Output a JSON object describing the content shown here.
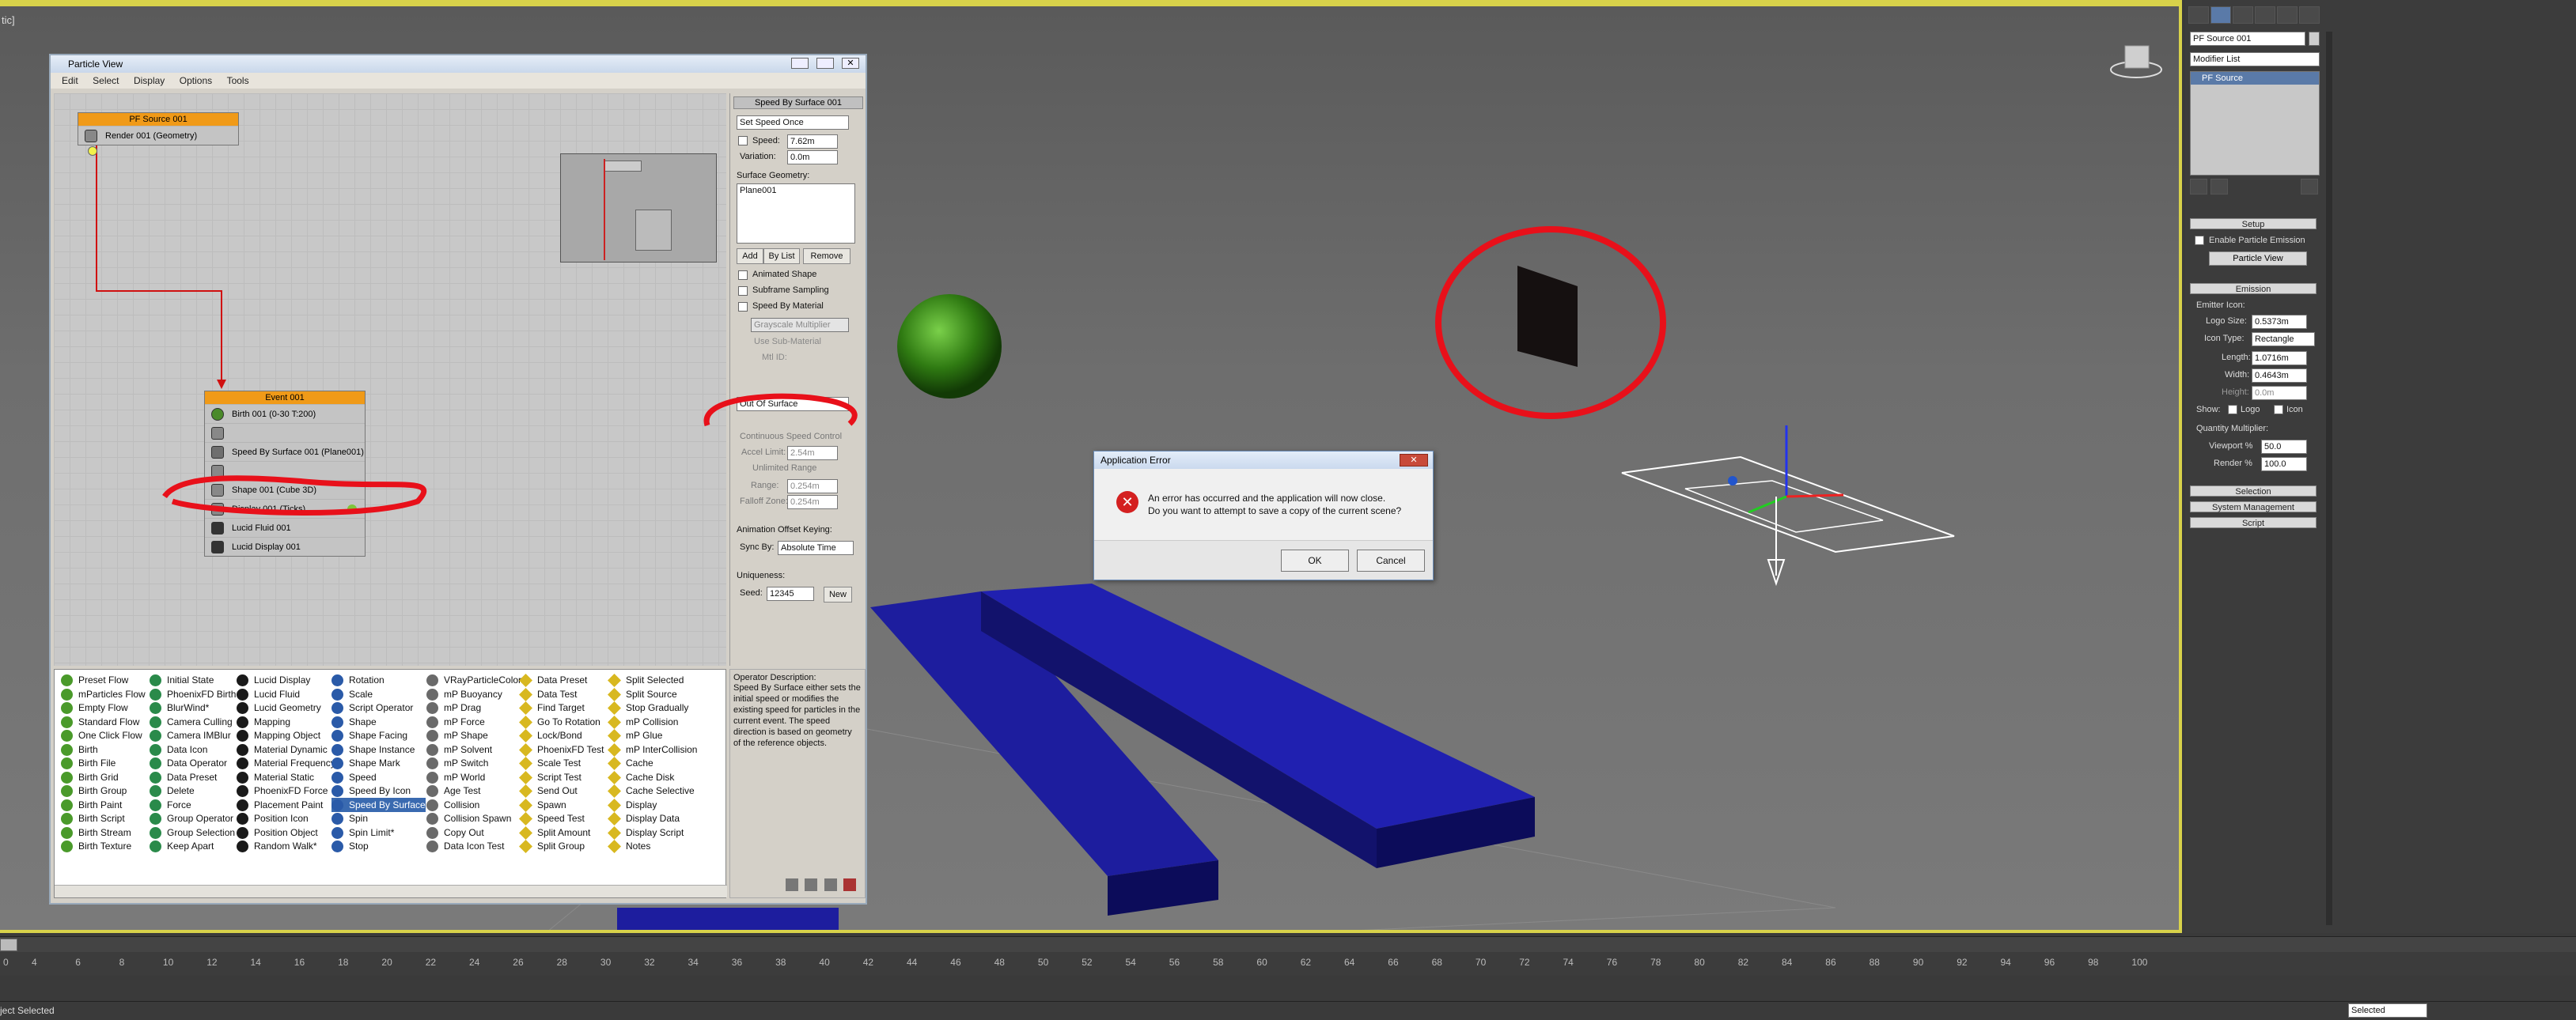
{
  "viewport": {
    "corner_label": "tic]"
  },
  "particle_view": {
    "title": "Particle View",
    "menu": [
      "Edit",
      "Select",
      "Display",
      "Options",
      "Tools"
    ],
    "pf_source": {
      "header": "PF Source 001",
      "row": "Render 001 (Geometry)"
    },
    "event": {
      "header": "Event 001",
      "rows": [
        "Birth 001 (0-30 T:200)",
        "",
        "Speed By Surface 001 (Plane001)",
        "",
        "Shape 001 (Cube 3D)",
        "Display 001 (Ticks)",
        "Lucid Fluid 001",
        "Lucid Display 001"
      ]
    },
    "params": {
      "rollout_title": "Speed By Surface 001",
      "mode": "Set Speed Once",
      "speed_label": "Speed:",
      "speed_value": "7.62m",
      "variation_label": "Variation:",
      "variation_value": "0.0m",
      "surface_geometry_label": "Surface Geometry:",
      "surface_item": "Plane001",
      "add": "Add",
      "by_list": "By List",
      "remove": "Remove",
      "animated_shape": "Animated Shape",
      "subframe_sampling": "Subframe Sampling",
      "speed_by_material": "Speed By Material",
      "grayscale": "Grayscale Multiplier",
      "use_sub_material": "Use Sub-Material",
      "mtl_id": "Mtl ID:",
      "direction": "Out Of Surface",
      "continuous": "Continuous Speed Control",
      "accel_limit": "Accel Limit:",
      "accel_value": "2.54m",
      "unlimited_range": "Unlimited Range",
      "range": "Range:",
      "range_value": "0.254m",
      "falloff_zone": "Falloff Zone:",
      "falloff_value": "0.254m",
      "anim_offset": "Animation Offset Keying:",
      "sync_by": "Sync By:",
      "sync_value": "Absolute Time",
      "uniqueness": "Uniqueness:",
      "seed": "Seed:",
      "seed_value": "12345",
      "new": "New"
    },
    "operator_description": {
      "title": "Operator Description:",
      "body": "Speed By Surface either sets the initial speed or modifies the existing speed for particles in the current event. The speed direction is based on geometry of the reference objects."
    },
    "depot": [
      [
        "Preset Flow",
        "mParticles Flow",
        "Empty Flow",
        "Standard Flow",
        "One Click Flow",
        "Birth",
        "Birth File",
        "Birth Grid",
        "Birth Group",
        "Birth Paint",
        "Birth Script",
        "Birth Stream",
        "Birth Texture"
      ],
      [
        "Initial State",
        "PhoenixFD Birth",
        "BlurWind*",
        "Camera Culling",
        "Camera IMBlur",
        "Data Icon",
        "Data Operator",
        "Data Preset",
        "Delete",
        "Force",
        "Group Operator",
        "Group Selection",
        "Keep Apart"
      ],
      [
        "Lucid Display",
        "Lucid Fluid",
        "Lucid Geometry",
        "Mapping",
        "Mapping Object",
        "Material Dynamic",
        "Material Frequency",
        "Material Static",
        "PhoenixFD Force",
        "Placement Paint",
        "Position Icon",
        "Position Object",
        "Random Walk*"
      ],
      [
        "Rotation",
        "Scale",
        "Script Operator",
        "Shape",
        "Shape Facing",
        "Shape Instance",
        "Shape Mark",
        "Speed",
        "Speed By Icon",
        "Speed By Surface",
        "Spin",
        "Spin Limit*",
        "Stop"
      ],
      [
        "VRayParticleColor",
        "mP Buoyancy",
        "mP Drag",
        "mP Force",
        "mP Shape",
        "mP Solvent",
        "mP Switch",
        "mP World",
        "Age Test",
        "Collision",
        "Collision Spawn",
        "Copy Out",
        "Data Icon Test"
      ],
      [
        "Data Preset",
        "Data Test",
        "Find Target",
        "Go To Rotation",
        "Lock/Bond",
        "PhoenixFD Test",
        "Scale Test",
        "Script Test",
        "Send Out",
        "Spawn",
        "Speed Test",
        "Split Amount",
        "Split Group"
      ],
      [
        "Split Selected",
        "Split Source",
        "Stop Gradually",
        "mP Collision",
        "mP Glue",
        "mP InterCollision",
        "Cache",
        "Cache Disk",
        "Cache Selective",
        "Display",
        "Display Data",
        "Display Script",
        "Notes"
      ]
    ]
  },
  "error_dialog": {
    "title": "Application Error",
    "line1": "An error has occurred and the application will now close.",
    "line2": "Do you want to attempt to save a copy of the current scene?",
    "ok": "OK",
    "cancel": "Cancel"
  },
  "command_panel": {
    "object_name": "PF Source 001",
    "modifier_list": "Modifier List",
    "stack_item": "PF Source",
    "setup": "Setup",
    "enable_emission": "Enable Particle Emission",
    "particle_view_btn": "Particle View",
    "emission": "Emission",
    "emitter_icon": "Emitter Icon:",
    "logo_size": "Logo Size:",
    "logo_size_value": "0.5373m",
    "icon_type": "Icon Type:",
    "icon_type_value": "Rectangle",
    "length": "Length:",
    "length_value": "1.0716m",
    "width": "Width:",
    "width_value": "0.4643m",
    "height": "Height:",
    "height_value": "0.0m",
    "show": "Show:",
    "logo": "Logo",
    "icon": "Icon",
    "quantity_multiplier": "Quantity Multiplier:",
    "viewport_pct": "Viewport %",
    "viewport_value": "50.0",
    "render_pct": "Render %",
    "render_value": "100.0",
    "selection": "Selection",
    "system_management": "System Management",
    "script": "Script"
  },
  "timeline": {
    "ticks": [
      "0",
      "4",
      "6",
      "8",
      "10",
      "12",
      "14",
      "16",
      "18",
      "20",
      "22",
      "24",
      "26",
      "28",
      "30",
      "32",
      "34",
      "36",
      "38",
      "40",
      "42",
      "44",
      "46",
      "48",
      "50",
      "52",
      "54",
      "56",
      "58",
      "60",
      "62",
      "64",
      "66",
      "68",
      "70",
      "72",
      "74",
      "76",
      "78",
      "80",
      "82",
      "84",
      "86",
      "88",
      "90",
      "92",
      "94",
      "96",
      "98",
      "100"
    ]
  },
  "status": {
    "left": "ject Selected",
    "selection_mode": "Selected"
  },
  "colors": {
    "accent": "#d8d24a",
    "node_orange": "#f09a18",
    "annotation_red": "#e8101a",
    "blocks_blue": "#1a1a8a"
  }
}
